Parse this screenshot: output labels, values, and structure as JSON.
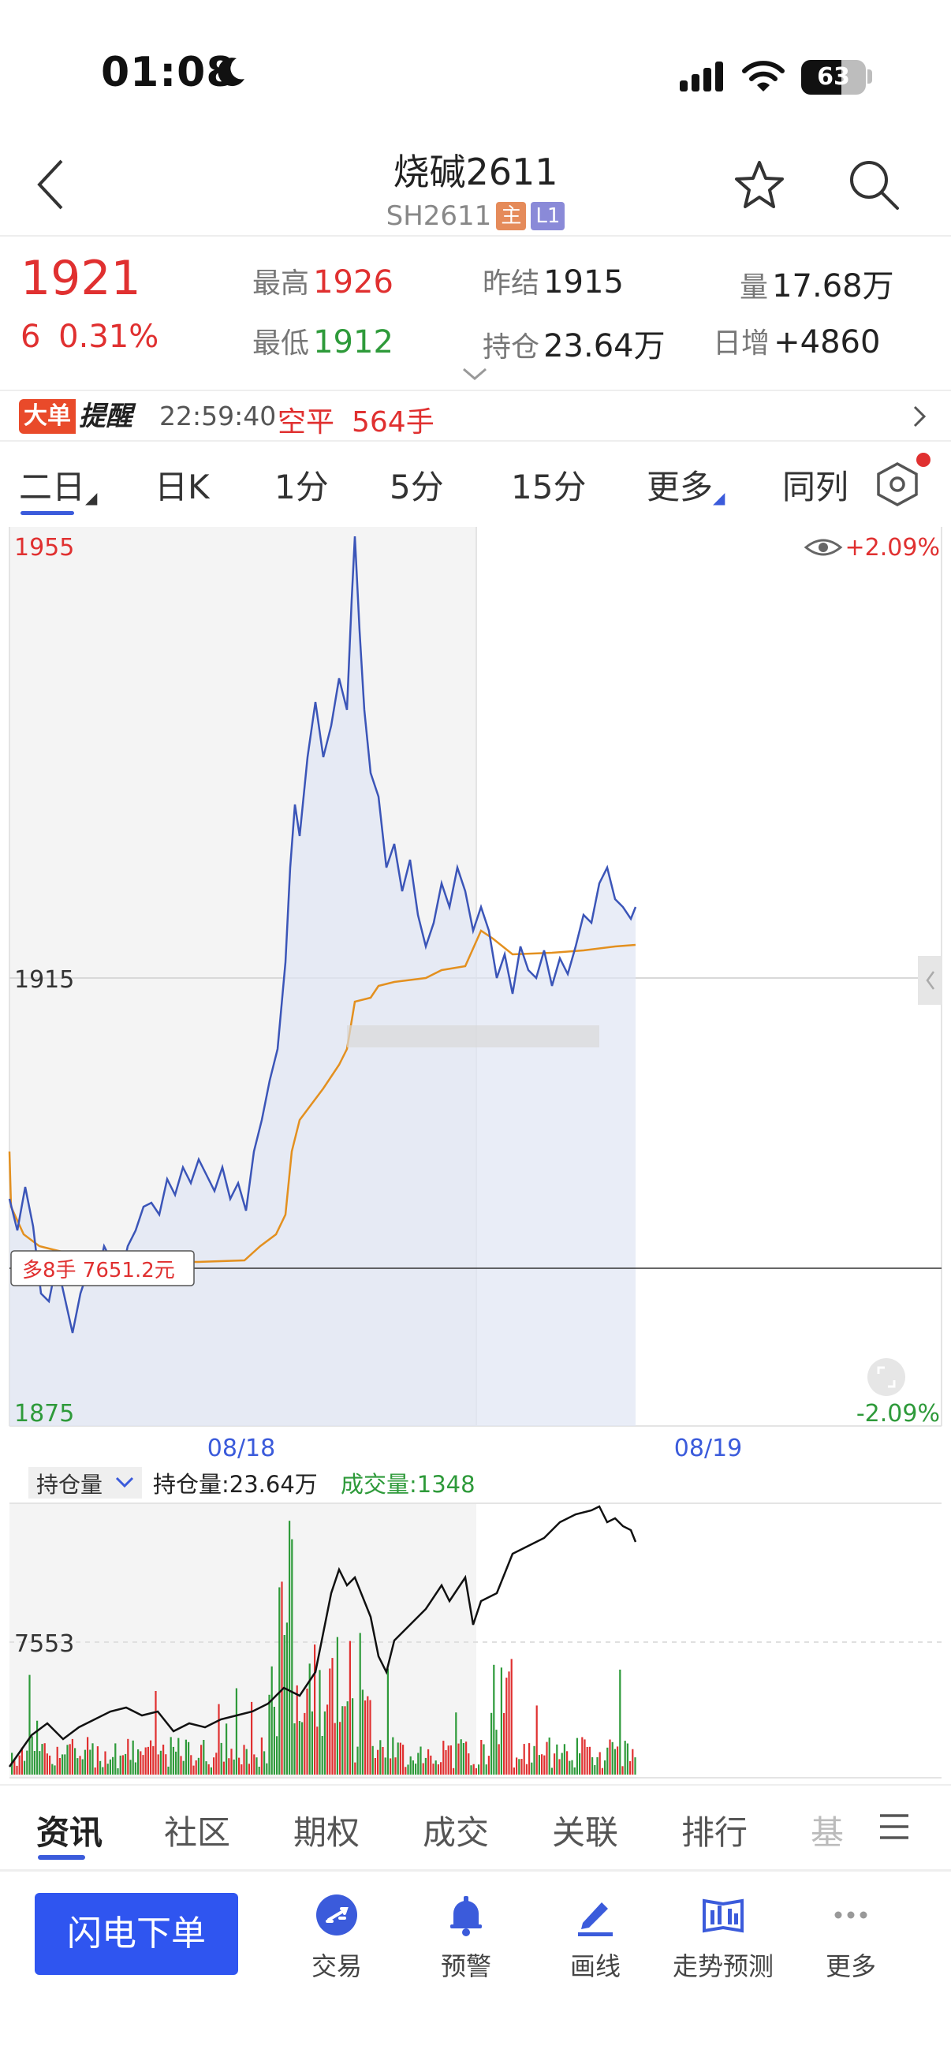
{
  "status_bar": {
    "time": "01:08",
    "battery": "63"
  },
  "header": {
    "title": "烧碱2611",
    "code": "SH2611",
    "tag_main": "主",
    "tag_l1": "L1"
  },
  "quote": {
    "price": "1921",
    "change": "6  0.31%",
    "high_label": "最高",
    "high": "1926",
    "low_label": "最低",
    "low": "1912",
    "prev_settle_label": "昨结",
    "prev_settle": "1915",
    "open_interest_label": "持仓",
    "open_interest": "23.64万",
    "volume_label": "量",
    "volume": "17.68万",
    "daily_increase_label": "日增",
    "daily_increase": "+4860"
  },
  "alert": {
    "big": "大单",
    "remind": "提醒",
    "time": "22:59:40",
    "action": "空平",
    "qty": "564手"
  },
  "period_tabs": [
    "二日",
    "日K",
    "1分",
    "5分",
    "15分",
    "更多",
    "同列"
  ],
  "chart": {
    "y_top": "1955",
    "y_mid": "1915",
    "y_bottom": "1875",
    "pct_top": "+2.09%",
    "pct_bottom": "-2.09%",
    "date1": "08/18",
    "date2": "08/19",
    "position_label": "多8手 7651.2元",
    "sub_selector": "持仓量",
    "sub_oi_label": "持仓量:23.64万",
    "sub_vol_label": "成交量:1348",
    "sub_y_label": "7553",
    "colors": {
      "price": "#3b55b8",
      "avg": "#e3901f",
      "up": "#e03030",
      "down": "#2e9a3a"
    }
  },
  "chart_data": {
    "type": "line",
    "x": [
      "08/18",
      "08/19"
    ],
    "ylim": [
      1875,
      1955
    ],
    "series": [],
    "sub_chart": {
      "type": "bar"
    }
  },
  "bottom_tabs": [
    "资讯",
    "社区",
    "期权",
    "成交",
    "关联",
    "排行",
    "基"
  ],
  "actions": {
    "flash_order": "闪电下单",
    "trade": "交易",
    "alert": "预警",
    "draw": "画线",
    "trend": "走势预测",
    "more": "更多"
  }
}
